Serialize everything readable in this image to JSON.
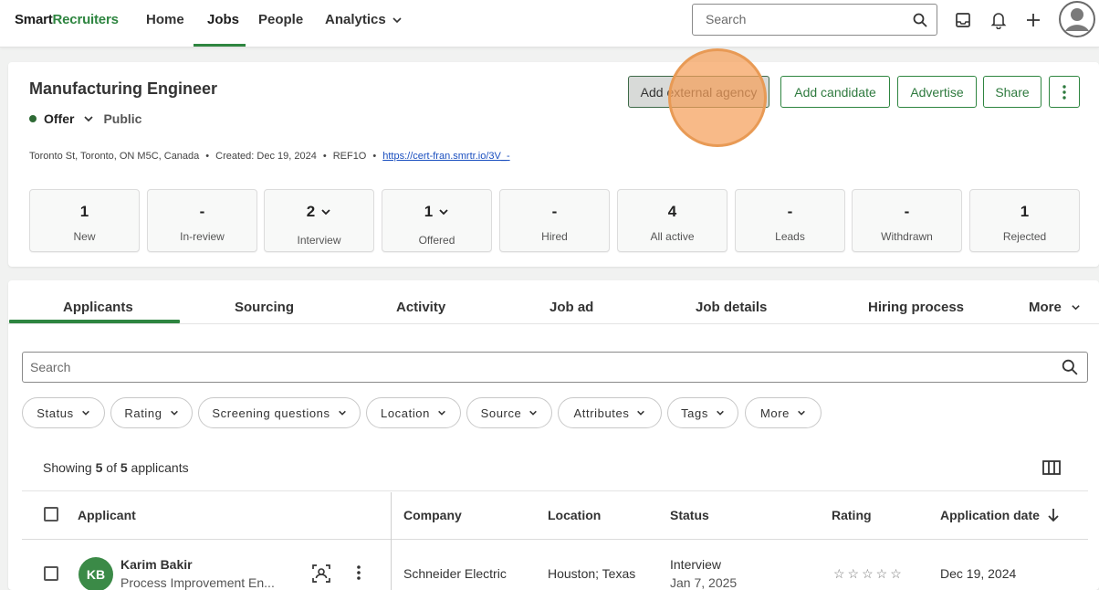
{
  "nav": {
    "logo_part1": "Smart",
    "logo_part2": "Recruiters",
    "items": [
      "Home",
      "Jobs",
      "People",
      "Analytics"
    ],
    "active": "Jobs",
    "search_placeholder": "Search"
  },
  "job": {
    "title": "Manufacturing Engineer",
    "status": "Offer",
    "visibility": "Public",
    "address": "Toronto St, Toronto, ON M5C, Canada",
    "created": "Created: Dec 19, 2024",
    "ref": "REF1O",
    "link": "https://cert-fran.smrtr.io/3V_-",
    "buttons": {
      "add_agency": "Add external agency",
      "add_candidate": "Add candidate",
      "advertise": "Advertise",
      "share": "Share"
    }
  },
  "stats": [
    {
      "value": "1",
      "label": "New"
    },
    {
      "value": "-",
      "label": "In-review"
    },
    {
      "value": "2",
      "label": "Interview"
    },
    {
      "value": "1",
      "label": "Offered"
    },
    {
      "value": "-",
      "label": "Hired"
    },
    {
      "value": "4",
      "label": "All active"
    },
    {
      "value": "-",
      "label": "Leads"
    },
    {
      "value": "-",
      "label": "Withdrawn"
    },
    {
      "value": "1",
      "label": "Rejected"
    }
  ],
  "tabs": [
    "Applicants",
    "Sourcing",
    "Activity",
    "Job ad",
    "Job details",
    "Hiring process",
    "More"
  ],
  "list": {
    "search_placeholder": "Search",
    "filters": [
      "Status",
      "Rating",
      "Screening questions",
      "Location",
      "Source",
      "Attributes",
      "Tags",
      "More"
    ],
    "showing_prefix": "Showing ",
    "showing_count": "5",
    "showing_of": " of ",
    "showing_total": "5",
    "showing_suffix": " applicants",
    "headers": {
      "applicant": "Applicant",
      "company": "Company",
      "location": "Location",
      "status": "Status",
      "rating": "Rating",
      "date": "Application date"
    },
    "rows": [
      {
        "initials": "KB",
        "name": "Karim Bakir",
        "title": "Process Improvement En...",
        "company": "Schneider Electric",
        "location": "Houston; Texas",
        "status": "Interview",
        "status_date": "Jan 7, 2025",
        "rating_stars": 0,
        "date": "Dec 19, 2024"
      }
    ]
  },
  "colors": {
    "brand": "#2e8540",
    "avatar": "#3b8a47",
    "focus_ripple": "#f5a05a"
  }
}
